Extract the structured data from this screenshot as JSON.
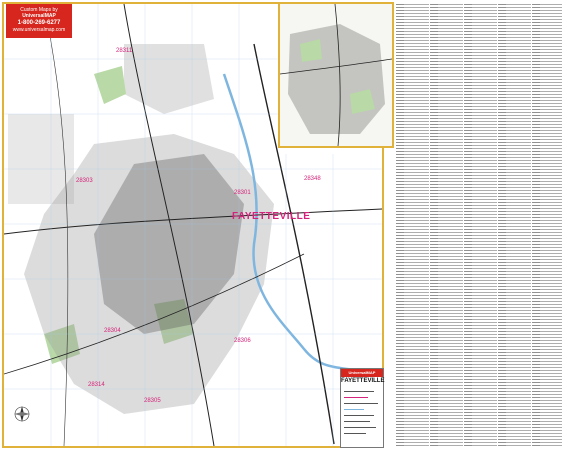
{
  "map": {
    "city_label": "FAYETTEVILLE",
    "zip_labels": [
      "28311",
      "28303",
      "28301",
      "28304",
      "28306",
      "28314",
      "28305",
      "28348"
    ],
    "colors": {
      "frame": "#e0b23a",
      "zip_label": "#d4237a",
      "water": "#7fb6e0",
      "park": "#b9d9a6",
      "military": "#d8d8d8",
      "roads": "#222222"
    }
  },
  "logo": {
    "line1": "Custom Maps by",
    "line2": "UniversalMAP",
    "line3": "1-800-269-6277",
    "line4": "www.universalmap.com"
  },
  "title_block": {
    "brand": "UniversalMAP",
    "title": "FAYETTEVILLE"
  },
  "icons": {
    "compass": "compass-rose-icon"
  }
}
